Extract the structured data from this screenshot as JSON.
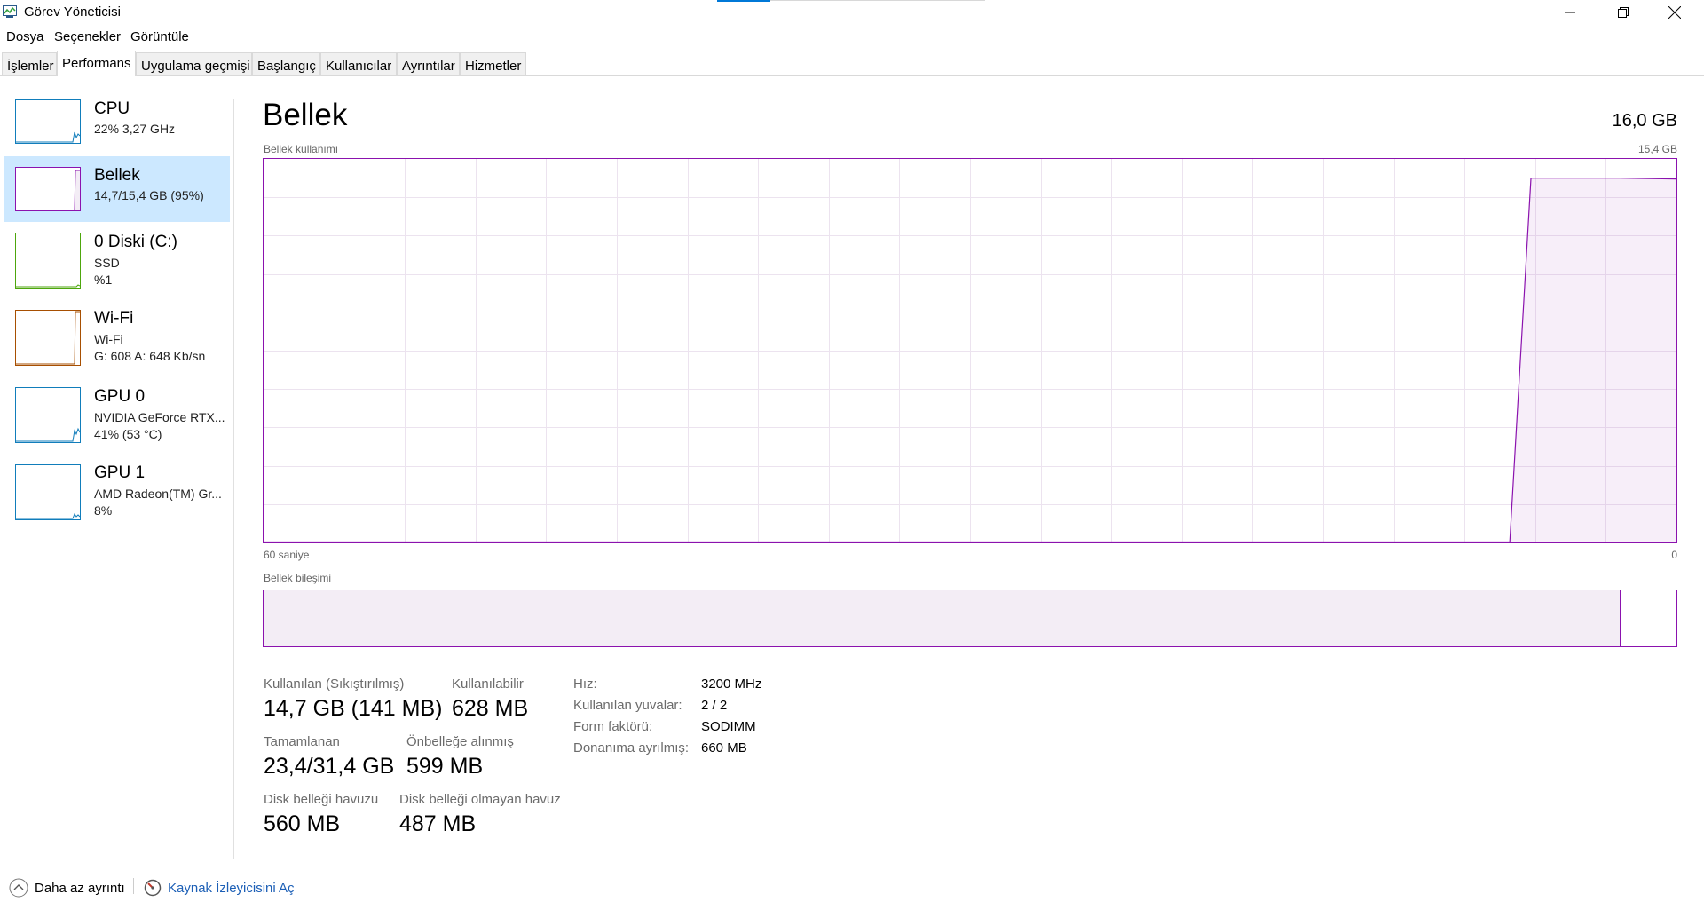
{
  "window": {
    "title": "Görev Yöneticisi",
    "icon": "task-manager-icon"
  },
  "menu": [
    "Dosya",
    "Seçenekler",
    "Görüntüle"
  ],
  "tabs": [
    {
      "label": "İşlemler",
      "active": false
    },
    {
      "label": "Performans",
      "active": true
    },
    {
      "label": "Uygulama geçmişi",
      "active": false
    },
    {
      "label": "Başlangıç",
      "active": false
    },
    {
      "label": "Kullanıcılar",
      "active": false
    },
    {
      "label": "Ayrıntılar",
      "active": false
    },
    {
      "label": "Hizmetler",
      "active": false
    }
  ],
  "sidebar": {
    "items": [
      {
        "title": "CPU",
        "line1": "22% 3,27 GHz",
        "line2": "",
        "color": "#117dbb",
        "selected": false,
        "usage": 0.22
      },
      {
        "title": "Bellek",
        "line1": "14,7/15,4 GB (95%)",
        "line2": "",
        "color": "#8b12ae",
        "selected": true,
        "usage": 0.95
      },
      {
        "title": "0 Diski (C:)",
        "line1": "SSD",
        "line2": "%1",
        "color": "#4da60c",
        "selected": false,
        "usage": 0.01
      },
      {
        "title": "Wi-Fi",
        "line1": "Wi-Fi",
        "line2": "G: 608 A: 648 Kb/sn",
        "color": "#a74f01",
        "selected": false,
        "usage": 0.9
      },
      {
        "title": "GPU 0",
        "line1": "NVIDIA GeForce RTX...",
        "line2": "41% (53 °C)",
        "color": "#117dbb",
        "selected": false,
        "usage": 0.41
      },
      {
        "title": "GPU 1",
        "line1": "AMD Radeon(TM) Gr...",
        "line2": "8%",
        "color": "#117dbb",
        "selected": false,
        "usage": 0.08
      }
    ]
  },
  "main": {
    "title": "Bellek",
    "total": "16,0 GB",
    "usage_chart": {
      "label": "Bellek kullanımı",
      "max_label": "15,4 GB",
      "time_left": "60 saniye",
      "time_right": "0",
      "color": "#8b12ae",
      "usage_fraction": 0.95
    },
    "composition": {
      "label": "Bellek bileşimi",
      "in_use_fraction": 0.96
    },
    "stats": {
      "in_use_label": "Kullanılan (Sıkıştırılmış)",
      "in_use_value": "14,7 GB (141 MB)",
      "available_label": "Kullanılabilir",
      "available_value": "628 MB",
      "committed_label": "Tamamlanan",
      "committed_value": "23,4/31,4 GB",
      "cached_label": "Önbelleğe alınmış",
      "cached_value": "599 MB",
      "paged_label": "Disk belleği havuzu",
      "paged_value": "560 MB",
      "nonpaged_label": "Disk belleği olmayan havuz",
      "nonpaged_value": "487 MB"
    },
    "properties": [
      {
        "label": "Hız:",
        "value": "3200 MHz"
      },
      {
        "label": "Kullanılan yuvalar:",
        "value": "2 / 2"
      },
      {
        "label": "Form faktörü:",
        "value": "SODIMM"
      },
      {
        "label": "Donanıma ayrılmış:",
        "value": "660 MB"
      }
    ]
  },
  "footer": {
    "fewer_details": "Daha az ayrıntı",
    "resource_monitor": "Kaynak İzleyicisini Aç"
  }
}
